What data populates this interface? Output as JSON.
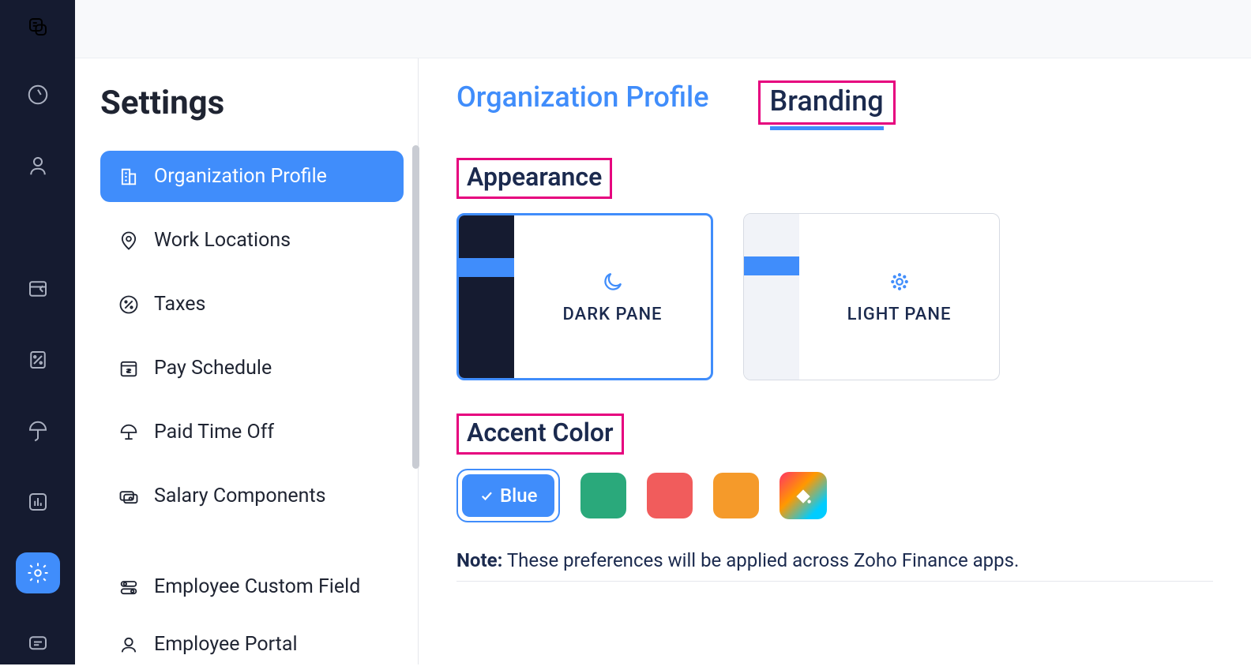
{
  "sidebar": {
    "title": "Settings",
    "items": [
      {
        "label": "Organization Profile"
      },
      {
        "label": "Work Locations"
      },
      {
        "label": "Taxes"
      },
      {
        "label": "Pay Schedule"
      },
      {
        "label": "Paid Time Off"
      },
      {
        "label": "Salary Components"
      },
      {
        "label": "Employee Custom Field"
      },
      {
        "label": "Employee Portal"
      }
    ]
  },
  "tabs": {
    "org_profile": "Organization Profile",
    "branding": "Branding"
  },
  "appearance": {
    "title": "Appearance",
    "dark_label": "DARK PANE",
    "light_label": "LIGHT PANE"
  },
  "accent": {
    "title": "Accent Color",
    "blue_label": "Blue"
  },
  "note": {
    "prefix": "Note:",
    "text": " These preferences will be applied across Zoho Finance apps."
  },
  "colors": {
    "blue": "#408dfb",
    "green": "#2aa97b",
    "red": "#f15c5c",
    "orange": "#f59a2a"
  }
}
